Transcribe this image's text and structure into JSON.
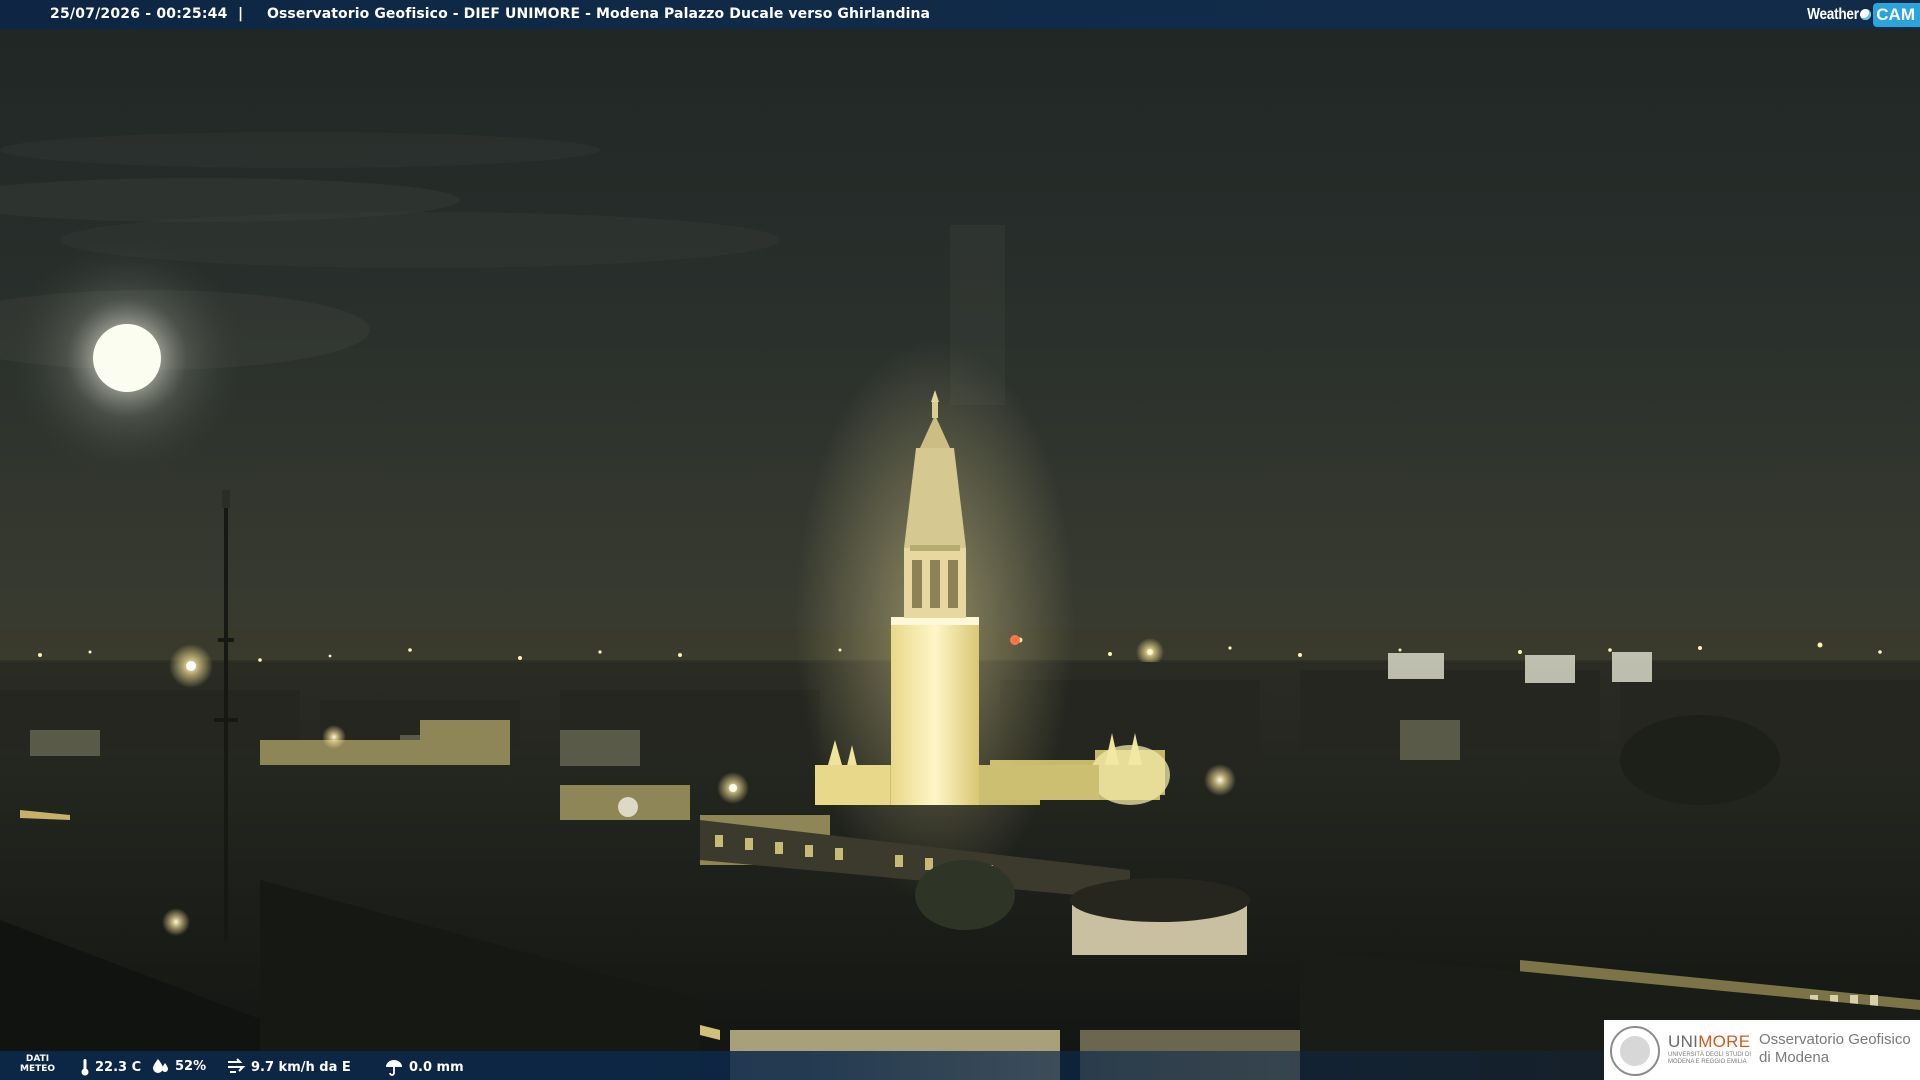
{
  "header": {
    "datetime": "25/07/2026 - 00:25:44",
    "separator": "|",
    "title": "Osservatorio Geofisico - DIEF UNIMORE - Modena Palazzo Ducale verso Ghirlandina",
    "brand_weather": "Weather",
    "brand_cam": "CAM"
  },
  "footer": {
    "meteo_label_line1": "DATI",
    "meteo_label_line2": "METEO",
    "temperature": "22.3 C",
    "humidity": "52%",
    "wind": "9.7 km/h da E",
    "rain": "0.0 mm",
    "icons": [
      "thermometer-icon",
      "humidity-drop-icon",
      "wind-icon",
      "rain-icon"
    ]
  },
  "logo": {
    "uni_prefix": "UNI",
    "uni_suffix": "MORE",
    "uni_sub_line1": "UNIVERSITÀ DEGLI STUDI DI",
    "uni_sub_line2": "MODENA E REGGIO EMILIA",
    "observatory_line1": "Osservatorio Geofisico",
    "observatory_line2": "di Modena"
  },
  "colors": {
    "bar_blue": "#0c284a",
    "cam_blue": "#2aa4dc",
    "unimore_orange": "#d35a1a"
  }
}
